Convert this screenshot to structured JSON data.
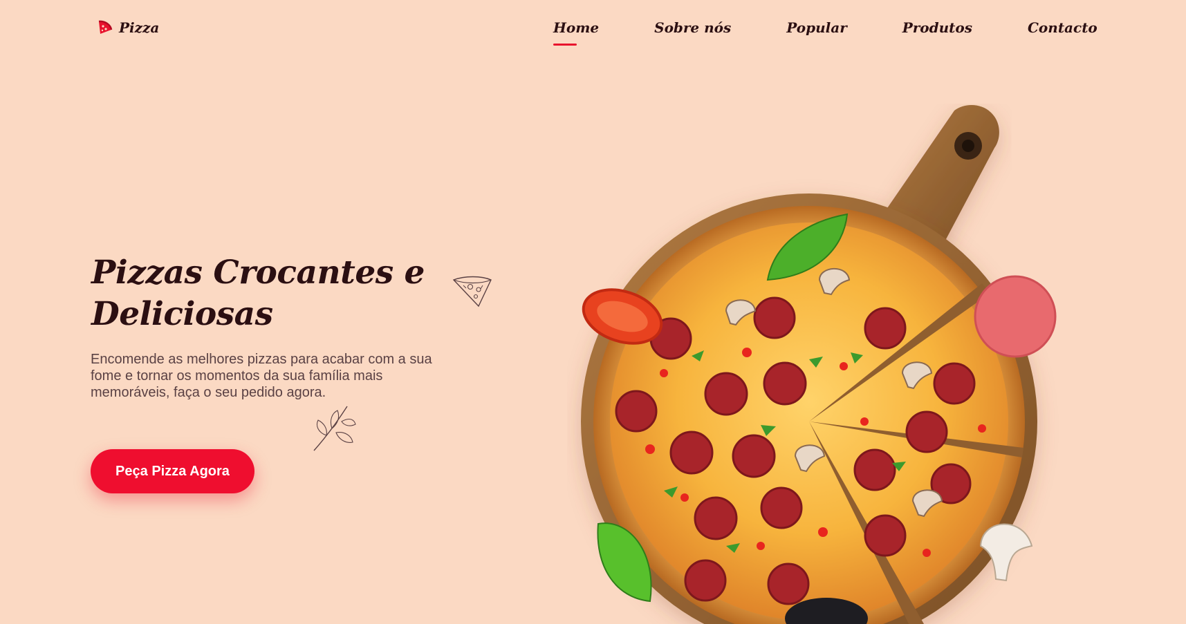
{
  "brand": {
    "name": "Pizza",
    "logo_icon": "pizza-slice-icon",
    "accent": "#e8112d"
  },
  "nav": {
    "items": [
      {
        "label": "Home",
        "active": true
      },
      {
        "label": "Sobre nós",
        "active": false
      },
      {
        "label": "Popular",
        "active": false
      },
      {
        "label": "Produtos",
        "active": false
      },
      {
        "label": "Contacto",
        "active": false
      }
    ]
  },
  "hero": {
    "title_line1": "Pizzas Crocantes e",
    "title_line2": "Deliciosas",
    "description": "Encomende as melhores pizzas para acabar com a sua fome e tornar os momentos da sua família mais memoráveis, faça o seu pedido agora.",
    "cta_label": "Peça Pizza Agora"
  },
  "colors": {
    "background": "#fbd9c3",
    "text": "#2b0f12",
    "button": "#ef0e2f"
  }
}
